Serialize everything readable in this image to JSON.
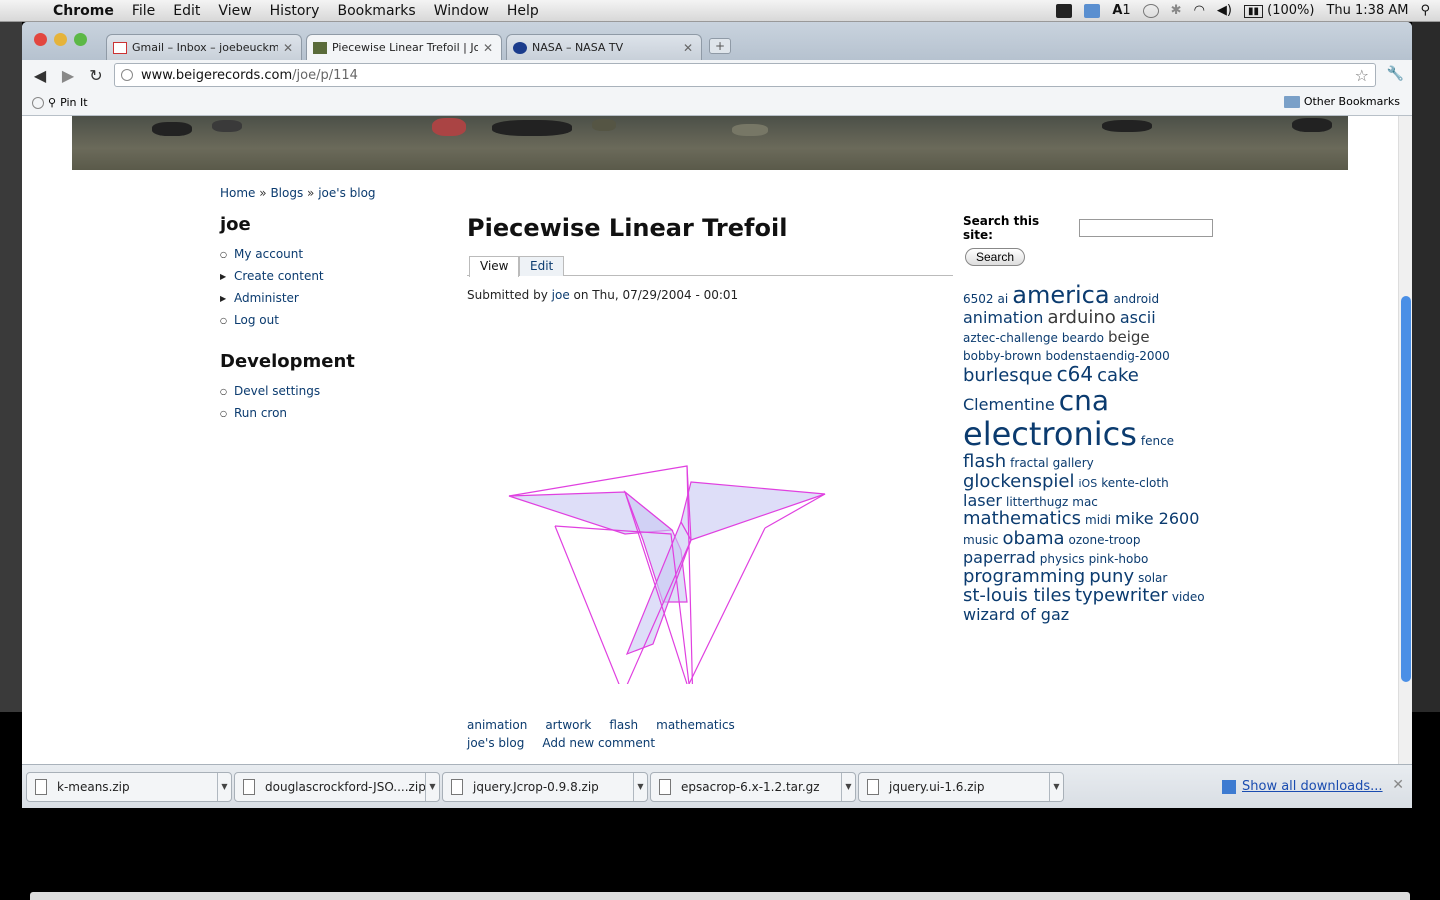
{
  "menubar": {
    "app": "Chrome",
    "items": [
      "File",
      "Edit",
      "View",
      "History",
      "Bookmarks",
      "Window",
      "Help"
    ],
    "battery": "(100%)",
    "clock": "Thu 1:38 AM",
    "badge_number": "1"
  },
  "tabs": [
    {
      "title": "Gmail – Inbox – joebeuckma",
      "icon": "gmail-icon"
    },
    {
      "title": "Piecewise Linear Trefoil | Joe",
      "icon": "beige-icon"
    },
    {
      "title": "NASA – NASA TV",
      "icon": "nasa-icon"
    }
  ],
  "address": {
    "host": "www.beigerecords.com",
    "path": "/joe/p/114"
  },
  "bookmarks": {
    "pin_it": "Pin It",
    "other": "Other Bookmarks"
  },
  "breadcrumb": {
    "home": "Home",
    "sep": "»",
    "blogs": "Blogs",
    "blog": "joe's blog"
  },
  "user_block": {
    "title": "joe",
    "items": [
      "My account",
      "Create content",
      "Administer",
      "Log out"
    ]
  },
  "dev_block": {
    "title": "Development",
    "items": [
      "Devel settings",
      "Run cron"
    ]
  },
  "node": {
    "title": "Piecewise Linear Trefoil",
    "tabs": [
      "View",
      "Edit"
    ],
    "submitted_prefix": "Submitted by",
    "author": "joe",
    "submitted_suffix": "on Thu, 07/29/2004 - 00:01",
    "terms": [
      "animation",
      "artwork",
      "flash",
      "mathematics"
    ],
    "links": [
      "joe's blog",
      "Add new comment"
    ]
  },
  "search": {
    "label": "Search this site:",
    "button": "Search",
    "value": ""
  },
  "tag_cloud": [
    {
      "t": "6502",
      "s": 12
    },
    {
      "t": "ai",
      "s": 12
    },
    {
      "t": "america",
      "s": 24
    },
    {
      "t": "android",
      "s": 12
    },
    {
      "t": "animation",
      "s": 16
    },
    {
      "t": "arduino",
      "s": 18
    },
    {
      "t": "ascii",
      "s": 16
    },
    {
      "t": "aztec-challenge",
      "s": 12
    },
    {
      "t": "beardo",
      "s": 12
    },
    {
      "t": "beige",
      "s": 15
    },
    {
      "t": "bobby-brown",
      "s": 12
    },
    {
      "t": "bodenstaendig-2000",
      "s": 12
    },
    {
      "t": "burlesque",
      "s": 18
    },
    {
      "t": "c64",
      "s": 20
    },
    {
      "t": "cake",
      "s": 18
    },
    {
      "t": "Clementine",
      "s": 16
    },
    {
      "t": "cna",
      "s": 28
    },
    {
      "t": "electronics",
      "s": 32
    },
    {
      "t": "fence",
      "s": 12
    },
    {
      "t": "flash",
      "s": 18
    },
    {
      "t": "fractal",
      "s": 12
    },
    {
      "t": "gallery",
      "s": 12
    },
    {
      "t": "glockenspiel",
      "s": 18
    },
    {
      "t": "iOS",
      "s": 11
    },
    {
      "t": "kente-cloth",
      "s": 12
    },
    {
      "t": "laser",
      "s": 16
    },
    {
      "t": "litterthugz",
      "s": 12
    },
    {
      "t": "mac",
      "s": 12
    },
    {
      "t": "mathematics",
      "s": 18
    },
    {
      "t": "midi",
      "s": 12
    },
    {
      "t": "mike 2600",
      "s": 16
    },
    {
      "t": "music",
      "s": 12
    },
    {
      "t": "obama",
      "s": 18
    },
    {
      "t": "ozone-troop",
      "s": 12
    },
    {
      "t": "paperrad",
      "s": 16
    },
    {
      "t": "physics",
      "s": 12
    },
    {
      "t": "pink-hobo",
      "s": 12
    },
    {
      "t": "programming",
      "s": 18
    },
    {
      "t": "puny",
      "s": 18
    },
    {
      "t": "solar",
      "s": 12
    },
    {
      "t": "st-louis tiles",
      "s": 18
    },
    {
      "t": "typewriter",
      "s": 18
    },
    {
      "t": "video",
      "s": 12
    },
    {
      "t": "wizard of gaz",
      "s": 16
    }
  ],
  "downloads": {
    "files": [
      "k-means.zip",
      "douglascrockford-JSO....zip",
      "jquery.Jcrop-0.9.8.zip",
      "epsacrop-6.x-1.2.tar.gz",
      "jquery.ui-1.6.zip"
    ],
    "show_all": "Show all downloads..."
  },
  "colors": {
    "link": "#0b3b6f",
    "trefoil_stroke": "#e040e0",
    "trefoil_fill": "#c8c8f4"
  }
}
